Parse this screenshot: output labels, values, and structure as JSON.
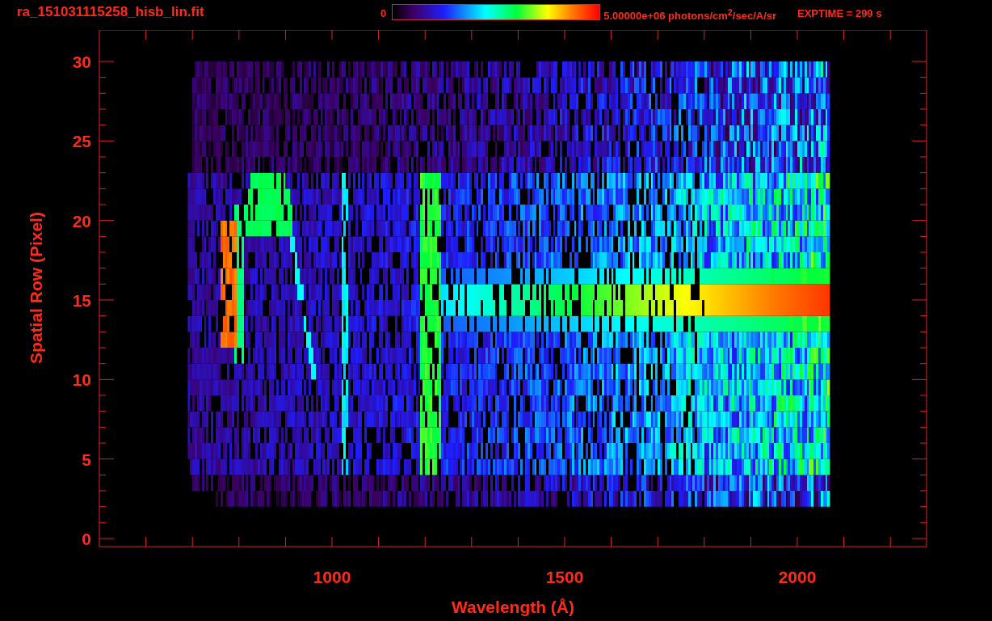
{
  "title": "ra_151031115258_hisb_lin.fit",
  "colorbar": {
    "min_label": "0",
    "max_label": "5.00000e+06 photons/cm$^{2}$/sec/A/sr"
  },
  "exptime": "EXPTIME = 299 s",
  "plot": {
    "xlabel": "Wavelength (Å)",
    "ylabel": "Spatial Row (Pixel)",
    "xticks": [
      "1000",
      "1500",
      "2000"
    ],
    "yticks": [
      "30",
      "25",
      "20",
      "15",
      "10",
      "5",
      "0"
    ]
  }
}
